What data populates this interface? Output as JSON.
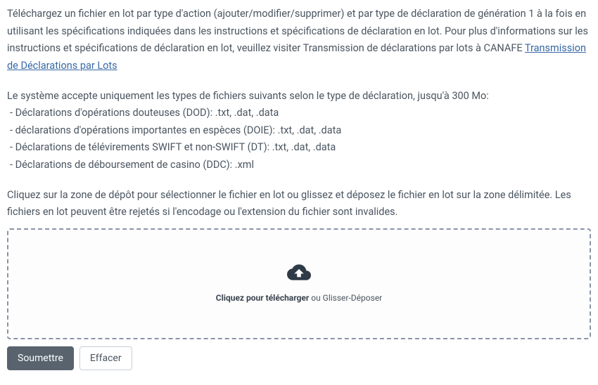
{
  "intro": {
    "text_before_link": "Téléchargez un fichier en lot par type d'action (ajouter/modifier/supprimer) et par type de déclaration de génération 1 à la fois en utilisant les spécifications indiquées dans les instructions et spécifications de déclaration en lot. Pour plus d'informations sur les instructions et spécifications de déclaration en lot, veuillez visiter Transmission de déclarations par lots à CANAFE ",
    "link_text": "Transmission de Déclarations par Lots"
  },
  "accepted": {
    "lead": "Le système accepte uniquement les types de fichiers suivants selon le type de déclaration, jusqu'à 300 Mo:",
    "items": [
      " - Déclarations d'opérations douteuses (DOD): .txt, .dat, .data",
      " - déclarations d'opérations importantes en espèces (DOIE): .txt, .dat, .data",
      " - Déclarations de télévirements SWIFT et non-SWIFT (DT): .txt, .dat, .data",
      " - Déclarations de déboursement de casino (DDC): .xml"
    ]
  },
  "dropzone_instructions": "Cliquez sur la zone de dépôt pour sélectionner le fichier en lot ou glissez et déposez le fichier en lot sur la zone délimitée. Les fichiers en lot peuvent être rejetés si l'encodage ou l'extension du fichier sont invalides.",
  "dropzone": {
    "click_label": "Cliquez pour télécharger",
    "suffix": " ou Glisser-Déposer"
  },
  "buttons": {
    "submit": "Soumettre",
    "clear": "Effacer"
  }
}
